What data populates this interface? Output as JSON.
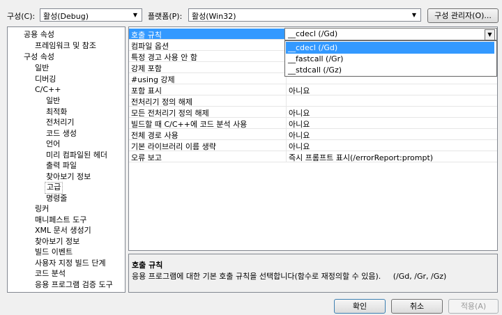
{
  "toolbar": {
    "config_label": "구성(C):",
    "config_value": "활성(Debug)",
    "platform_label": "플랫폼(P):",
    "platform_value": "활성(Win32)",
    "config_manager_label": "구성 관리자(O)..."
  },
  "tree": {
    "items": [
      {
        "label": "공용 속성"
      },
      {
        "label": "프레임워크 및 참조"
      },
      {
        "label": "구성 속성"
      },
      {
        "label": "일반"
      },
      {
        "label": "디버깅"
      },
      {
        "label": "C/C++"
      },
      {
        "label": "일반"
      },
      {
        "label": "최적화"
      },
      {
        "label": "전처리기"
      },
      {
        "label": "코드 생성"
      },
      {
        "label": "언어"
      },
      {
        "label": "미리 컴파일된 헤더"
      },
      {
        "label": "출력 파일"
      },
      {
        "label": "찾아보기 정보"
      },
      {
        "label": "고급"
      },
      {
        "label": "명령줄"
      },
      {
        "label": "링커"
      },
      {
        "label": "매니페스트 도구"
      },
      {
        "label": "XML 문서 생성기"
      },
      {
        "label": "찾아보기 정보"
      },
      {
        "label": "빌드 이벤트"
      },
      {
        "label": "사용자 지정 빌드 단계"
      },
      {
        "label": "코드 분석"
      },
      {
        "label": "응용 프로그램 검증 도구"
      }
    ]
  },
  "grid": {
    "rows": [
      {
        "name": "호출 규칙",
        "value": "__cdecl (/Gd)"
      },
      {
        "name": "컴파일 옵션",
        "value": ""
      },
      {
        "name": "특정 경고 사용 안 함",
        "value": ""
      },
      {
        "name": "강제 포함",
        "value": ""
      },
      {
        "name": "#using 강제",
        "value": ""
      },
      {
        "name": "포함 표시",
        "value": "아니요"
      },
      {
        "name": "전처리기 정의 해제",
        "value": ""
      },
      {
        "name": "모든 전처리기 정의 해제",
        "value": "아니요"
      },
      {
        "name": "빌드할 때 C/C++에 코드 분석 사용",
        "value": "아니요"
      },
      {
        "name": "전체 경로 사용",
        "value": "아니요"
      },
      {
        "name": "기본 라이브러리 이름 생략",
        "value": "아니요"
      },
      {
        "name": "오류 보고",
        "value": "즉시 프롬프트 표시(/errorReport:prompt)"
      }
    ]
  },
  "dropdown": {
    "options": [
      {
        "label": "__cdecl (/Gd)"
      },
      {
        "label": "__fastcall (/Gr)"
      },
      {
        "label": "__stdcall (/Gz)"
      }
    ]
  },
  "description": {
    "title": "호출 규칙",
    "text": "응용 프로그램에 대한 기본 호출 규칙을 선택합니다(함수로 재정의할 수 있음).     (/Gd, /Gr, /Gz)"
  },
  "buttons": {
    "ok": "확인",
    "cancel": "취소",
    "apply": "적용(A)"
  },
  "colors": {
    "selection": "#3399ff",
    "window_bg": "#f0f0f0"
  }
}
